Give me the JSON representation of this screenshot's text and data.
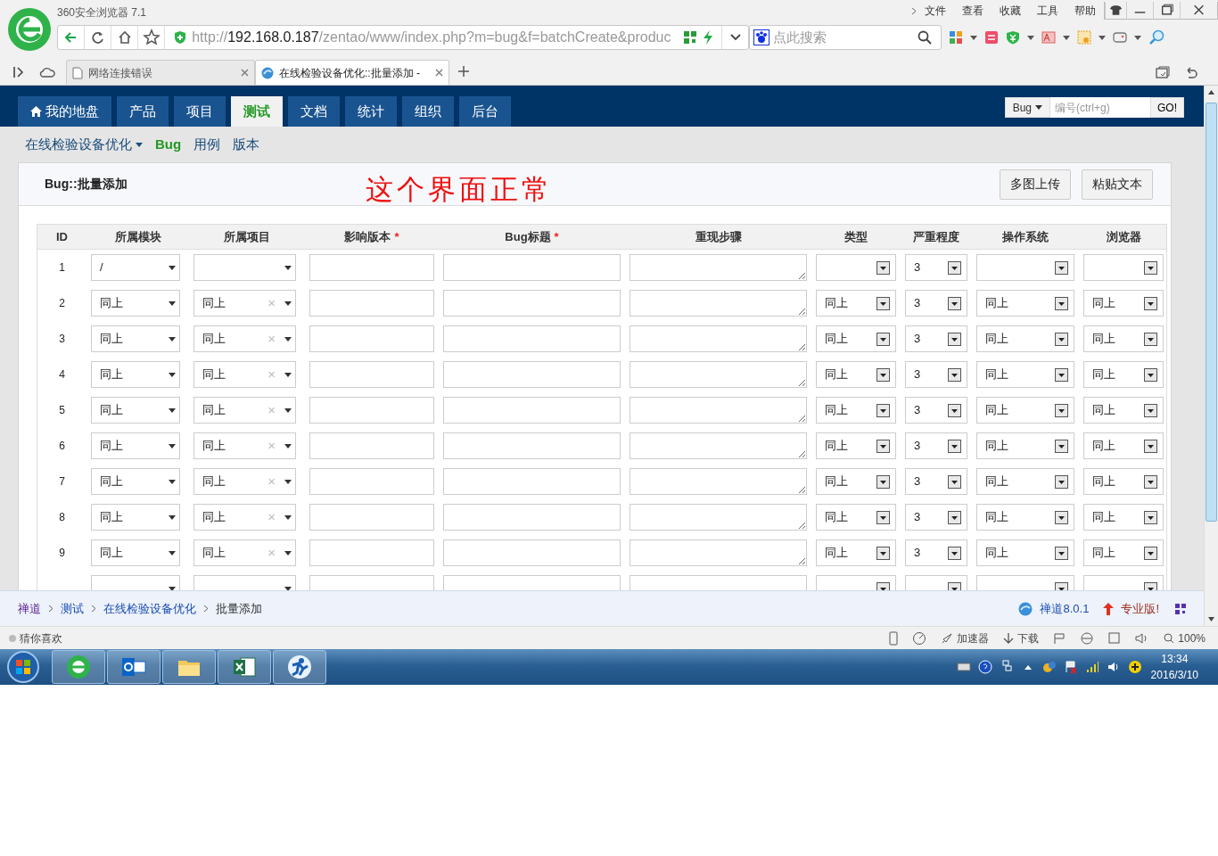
{
  "browser": {
    "title": "360安全浏览器 7.1",
    "menu": [
      "文件",
      "查看",
      "收藏",
      "工具",
      "帮助"
    ],
    "url_scheme": "http://",
    "url_host": "192.168.0.187",
    "url_path": "/zentao/www/index.php?m=bug&f=batchCreate&produc",
    "search_placeholder": "点此搜索",
    "tabs": [
      {
        "label": "网络连接错误",
        "selected": false
      },
      {
        "label": "在线检验设备优化::批量添加 -",
        "selected": true
      }
    ]
  },
  "app": {
    "nav": [
      {
        "label": "我的地盘",
        "kind": "home",
        "selected": false
      },
      {
        "label": "产品",
        "selected": false
      },
      {
        "label": "项目",
        "selected": false
      },
      {
        "label": "测试",
        "selected": true
      },
      {
        "label": "文档",
        "selected": false
      },
      {
        "label": "统计",
        "selected": false
      },
      {
        "label": "组织",
        "selected": false
      },
      {
        "label": "后台",
        "selected": false
      }
    ],
    "search": {
      "type": "Bug",
      "placeholder": "编号(ctrl+g)",
      "button": "GO!"
    },
    "subnav": [
      {
        "label": "在线检验设备优化",
        "kind": "dropdown",
        "selected": false
      },
      {
        "label": "Bug",
        "selected": true
      },
      {
        "label": "用例",
        "selected": false
      },
      {
        "label": "版本",
        "selected": false
      }
    ],
    "panel": {
      "title": "Bug::批量添加",
      "annotation": "这个界面正常",
      "buttons": [
        "多图上传",
        "粘贴文本"
      ]
    },
    "table": {
      "columns": [
        {
          "label": "ID"
        },
        {
          "label": "所属模块"
        },
        {
          "label": "所属项目"
        },
        {
          "label": "影响版本",
          "mark": "*"
        },
        {
          "label": "Bug标题",
          "mark": "*"
        },
        {
          "label": "重现步骤"
        },
        {
          "label": "类型"
        },
        {
          "label": "严重程度"
        },
        {
          "label": "操作系统"
        },
        {
          "label": "浏览器"
        }
      ],
      "rows": [
        {
          "id": "1",
          "module": "/",
          "severity": "3"
        },
        {
          "id": "2",
          "module": "同上",
          "project": "同上",
          "clear": "×",
          "type": "同上",
          "severity": "3",
          "os": "同上",
          "browser": "同上"
        },
        {
          "id": "3",
          "module": "同上",
          "project": "同上",
          "clear": "×",
          "type": "同上",
          "severity": "3",
          "os": "同上",
          "browser": "同上"
        },
        {
          "id": "4",
          "module": "同上",
          "project": "同上",
          "clear": "×",
          "type": "同上",
          "severity": "3",
          "os": "同上",
          "browser": "同上"
        },
        {
          "id": "5",
          "module": "同上",
          "project": "同上",
          "clear": "×",
          "type": "同上",
          "severity": "3",
          "os": "同上",
          "browser": "同上"
        },
        {
          "id": "6",
          "module": "同上",
          "project": "同上",
          "clear": "×",
          "type": "同上",
          "severity": "3",
          "os": "同上",
          "browser": "同上"
        },
        {
          "id": "7",
          "module": "同上",
          "project": "同上",
          "clear": "×",
          "type": "同上",
          "severity": "3",
          "os": "同上",
          "browser": "同上"
        },
        {
          "id": "8",
          "module": "同上",
          "project": "同上",
          "clear": "×",
          "type": "同上",
          "severity": "3",
          "os": "同上",
          "browser": "同上"
        },
        {
          "id": "9",
          "module": "同上",
          "project": "同上",
          "clear": "×",
          "type": "同上",
          "severity": "3",
          "os": "同上",
          "browser": "同上"
        },
        {}
      ]
    },
    "footer": {
      "breadcrumb": [
        "禅道",
        "测试",
        "在线检验设备优化",
        "批量添加"
      ],
      "version": "禅道8.0.1",
      "edition": "专业版!"
    }
  },
  "status_bar": {
    "left": "猜你喜欢",
    "accelerator": "加速器",
    "download": "下载",
    "zoom": "100%"
  },
  "taskbar": {
    "time": "13:34",
    "date": "2016/3/10"
  }
}
